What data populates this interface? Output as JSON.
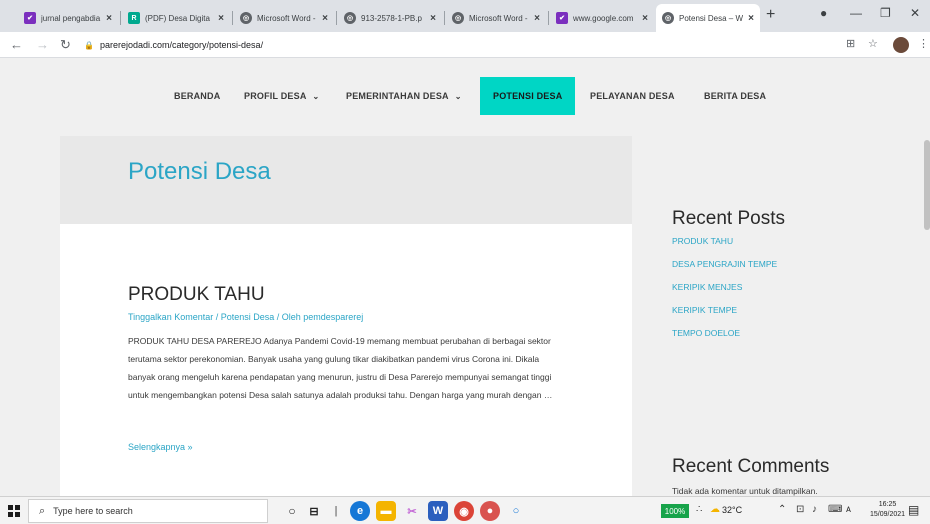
{
  "browser": {
    "tabs": [
      {
        "title": "jurnal pengabdia",
        "fav_color": "#7b2fbe",
        "fav_glyph": "✔"
      },
      {
        "title": "(PDF) Desa Digita",
        "fav_color": "#00a98f",
        "fav_glyph": "R"
      },
      {
        "title": "Microsoft Word -",
        "fav_color": "#5f6368",
        "fav_glyph": "◎"
      },
      {
        "title": "913-2578-1-PB.p",
        "fav_color": "#5f6368",
        "fav_glyph": "◎"
      },
      {
        "title": "Microsoft Word -",
        "fav_color": "#5f6368",
        "fav_glyph": "◎"
      },
      {
        "title": "www.google.com",
        "fav_color": "#7b2fbe",
        "fav_glyph": "✔"
      },
      {
        "title": "Potensi Desa – W",
        "fav_color": "#5f6368",
        "fav_glyph": "◎"
      }
    ],
    "new_tab": "+",
    "url": "parerejodadi.com/category/potensi-desa/"
  },
  "site": {
    "menu": [
      {
        "label": "BERANDA",
        "chevron": ""
      },
      {
        "label": "PROFIL DESA",
        "chevron": "⌄"
      },
      {
        "label": "PEMERINTAHAN DESA",
        "chevron": "⌄"
      },
      {
        "label": "POTENSI DESA",
        "chevron": ""
      },
      {
        "label": "PELAYANAN DESA",
        "chevron": ""
      },
      {
        "label": "BERITA DESA",
        "chevron": ""
      }
    ],
    "page_title": "Potensi Desa",
    "post": {
      "title": "PRODUK TAHU",
      "meta": "Tinggalkan Komentar / Potensi Desa / Oleh pemdesparerej",
      "excerpt": "PRODUK TAHU DESA PAREREJO Adanya Pandemi Covid-19 memang membuat perubahan di berbagai sektor terutama sektor perekonomian. Banyak usaha yang gulung tikar diakibatkan pandemi virus Corona ini. Dikala banyak orang mengeluh karena pendapatan yang menurun, justru di Desa Parerejo mempunyai semangat tinggi untuk mengembangkan potensi Desa salah satunya adalah produksi tahu. Dengan harga yang murah dengan …",
      "read_more": "Selengkapnya »"
    },
    "sidebar": {
      "recent_posts_title": "Recent Posts",
      "recent_posts": [
        "PRODUK TAHU",
        "DESA PENGRAJIN TEMPE",
        "KERIPIK MENJES",
        "KERIPIK TEMPE",
        "TEMPO DOELOE"
      ],
      "recent_comments_title": "Recent Comments",
      "recent_comments_empty": "Tidak ada komentar untuk ditampilkan."
    }
  },
  "taskbar": {
    "search_placeholder": "Type here to search",
    "battery": "100%",
    "weather": "32°C",
    "time": "16:25",
    "date": "15/09/2021"
  }
}
